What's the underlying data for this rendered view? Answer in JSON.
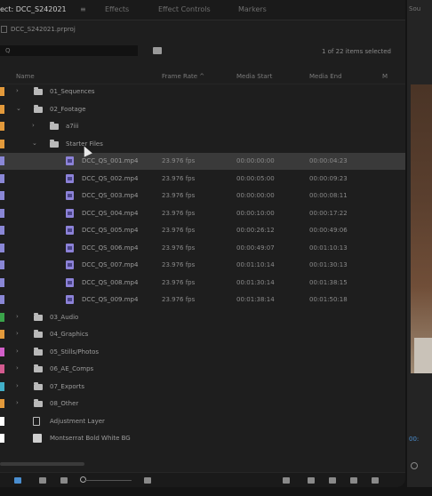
{
  "tabs": [
    {
      "label": "ect: DCC_S242021",
      "active": true
    },
    {
      "label": "Effects",
      "active": false
    },
    {
      "label": "Effect Controls",
      "active": false
    },
    {
      "label": "Markers",
      "active": false
    }
  ],
  "tab_menu_glyph": "≡",
  "project_file": "DCC_S242021.prproj",
  "search": {
    "value": "",
    "placeholder": "Q"
  },
  "items_count": "1 of 22 items selected",
  "columns": {
    "name": "Name",
    "frame_rate": "Frame Rate ^",
    "media_start": "Media Start",
    "media_end": "Media End",
    "extra": "M"
  },
  "colors": {
    "accent_blue": "#4a8ed0",
    "clip_purple": "#8c82d8",
    "label_orange": "#e39a3b",
    "label_lavender": "#8a87d6",
    "label_green": "#3aa44a",
    "label_magenta": "#d25fc9",
    "label_cyan": "#42b0c9",
    "label_pink": "#d35a8f"
  },
  "rows": [
    {
      "type": "folder",
      "indent": 0,
      "expanded": false,
      "name": "01_Sequences",
      "color": "#e39a3b"
    },
    {
      "type": "folder",
      "indent": 0,
      "expanded": true,
      "name": "02_Footage",
      "color": "#e39a3b"
    },
    {
      "type": "folder",
      "indent": 1,
      "expanded": false,
      "name": "a7iii",
      "color": "#e39a3b"
    },
    {
      "type": "folder",
      "indent": 1,
      "expanded": true,
      "name": "Starter Files",
      "color": "#e39a3b"
    },
    {
      "type": "clip",
      "name": "DCC_QS_001.mp4",
      "fps": "23.976 fps",
      "start": "00:00:00:00",
      "end": "00:00:04:23",
      "color": "#8a87d6",
      "selected": true
    },
    {
      "type": "clip",
      "name": "DCC_QS_002.mp4",
      "fps": "23.976 fps",
      "start": "00:00:05:00",
      "end": "00:00:09:23",
      "color": "#8a87d6",
      "selected": false
    },
    {
      "type": "clip",
      "name": "DCC_QS_003.mp4",
      "fps": "23.976 fps",
      "start": "00:00:00:00",
      "end": "00:00:08:11",
      "color": "#8a87d6",
      "selected": false
    },
    {
      "type": "clip",
      "name": "DCC_QS_004.mp4",
      "fps": "23.976 fps",
      "start": "00:00:10:00",
      "end": "00:00:17:22",
      "color": "#8a87d6",
      "selected": false
    },
    {
      "type": "clip",
      "name": "DCC_QS_005.mp4",
      "fps": "23.976 fps",
      "start": "00:00:26:12",
      "end": "00:00:49:06",
      "color": "#8a87d6",
      "selected": false
    },
    {
      "type": "clip",
      "name": "DCC_QS_006.mp4",
      "fps": "23.976 fps",
      "start": "00:00:49:07",
      "end": "00:01:10:13",
      "color": "#8a87d6",
      "selected": false
    },
    {
      "type": "clip",
      "name": "DCC_QS_007.mp4",
      "fps": "23.976 fps",
      "start": "00:01:10:14",
      "end": "00:01:30:13",
      "color": "#8a87d6",
      "selected": false
    },
    {
      "type": "clip",
      "name": "DCC_QS_008.mp4",
      "fps": "23.976 fps",
      "start": "00:01:30:14",
      "end": "00:01:38:15",
      "color": "#8a87d6",
      "selected": false
    },
    {
      "type": "clip",
      "name": "DCC_QS_009.mp4",
      "fps": "23.976 fps",
      "start": "00:01:38:14",
      "end": "00:01:50:18",
      "color": "#8a87d6",
      "selected": false
    },
    {
      "type": "folder",
      "indent": 0,
      "expanded": false,
      "name": "03_Audio",
      "color": "#3aa44a"
    },
    {
      "type": "folder",
      "indent": 0,
      "expanded": false,
      "name": "04_Graphics",
      "color": "#e39a3b"
    },
    {
      "type": "folder",
      "indent": 0,
      "expanded": false,
      "name": "05_Stills/Photos",
      "color": "#d25fc9"
    },
    {
      "type": "folder",
      "indent": 0,
      "expanded": false,
      "name": "06_AE_Comps",
      "color": "#d35a8f"
    },
    {
      "type": "folder",
      "indent": 0,
      "expanded": false,
      "name": "07_Exports",
      "color": "#42b0c9"
    },
    {
      "type": "folder",
      "indent": 0,
      "expanded": false,
      "name": "08_Other",
      "color": "#e39a3b"
    },
    {
      "type": "adjustment",
      "name": "Adjustment Layer",
      "color": "#ffffff"
    },
    {
      "type": "text",
      "name": "Montserrat Bold White BG",
      "color": "#ffffff"
    }
  ],
  "right_panel": {
    "tab": "Sou",
    "timecode": "00:"
  }
}
